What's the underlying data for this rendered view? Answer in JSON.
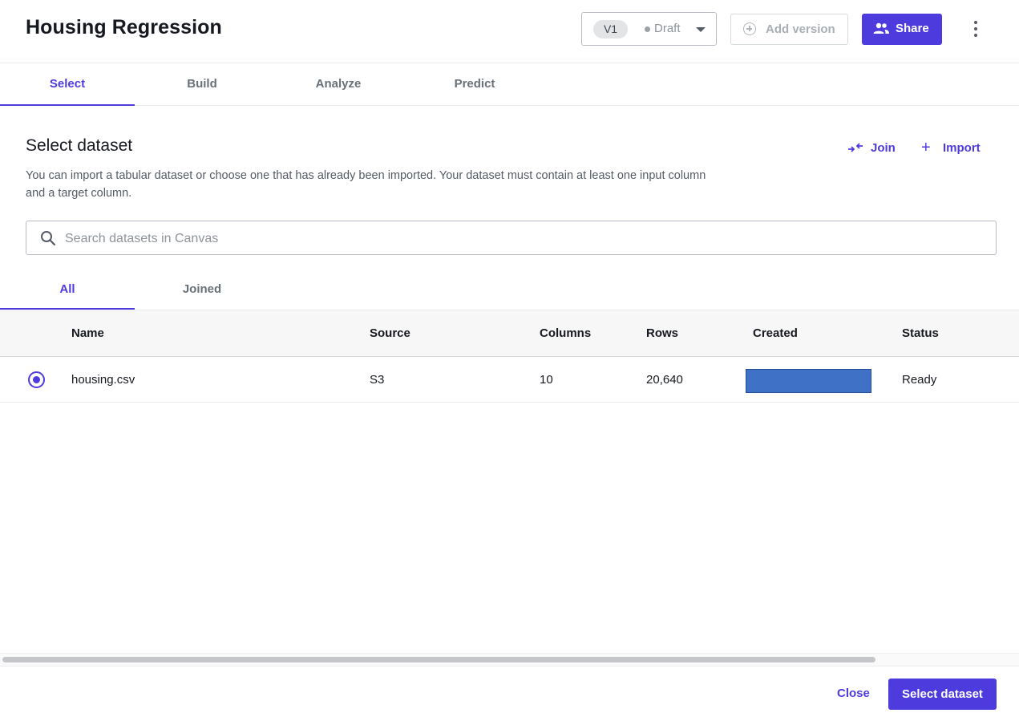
{
  "header": {
    "title": "Housing Regression",
    "version_label": "V1",
    "version_status": "Draft",
    "add_version_label": "Add version",
    "share_label": "Share"
  },
  "tabs": [
    {
      "label": "Select",
      "active": true
    },
    {
      "label": "Build",
      "active": false
    },
    {
      "label": "Analyze",
      "active": false
    },
    {
      "label": "Predict",
      "active": false
    }
  ],
  "section": {
    "title": "Select dataset",
    "join_label": "Join",
    "import_label": "Import",
    "description": "You can import a tabular dataset or choose one that has already been imported. Your dataset must contain at least one input column and a target column."
  },
  "search": {
    "placeholder": "Search datasets in Canvas",
    "value": ""
  },
  "filter_tabs": [
    {
      "label": "All",
      "active": true
    },
    {
      "label": "Joined",
      "active": false
    }
  ],
  "table": {
    "columns": [
      "Name",
      "Source",
      "Columns",
      "Rows",
      "Created",
      "Status"
    ],
    "rows": [
      {
        "selected": true,
        "name": "housing.csv",
        "source": "S3",
        "columns": "10",
        "rows": "20,640",
        "created": "",
        "status": "Ready"
      }
    ]
  },
  "footer": {
    "close_label": "Close",
    "select_label": "Select dataset"
  },
  "colors": {
    "accent": "#4d3bde",
    "redaction": "#3f72c6"
  },
  "icons": [
    "users-icon",
    "kebab-menu-icon",
    "plus-circle-icon",
    "join-icon",
    "plus-icon",
    "search-icon",
    "chevron-down-icon",
    "radio-selected-icon"
  ]
}
